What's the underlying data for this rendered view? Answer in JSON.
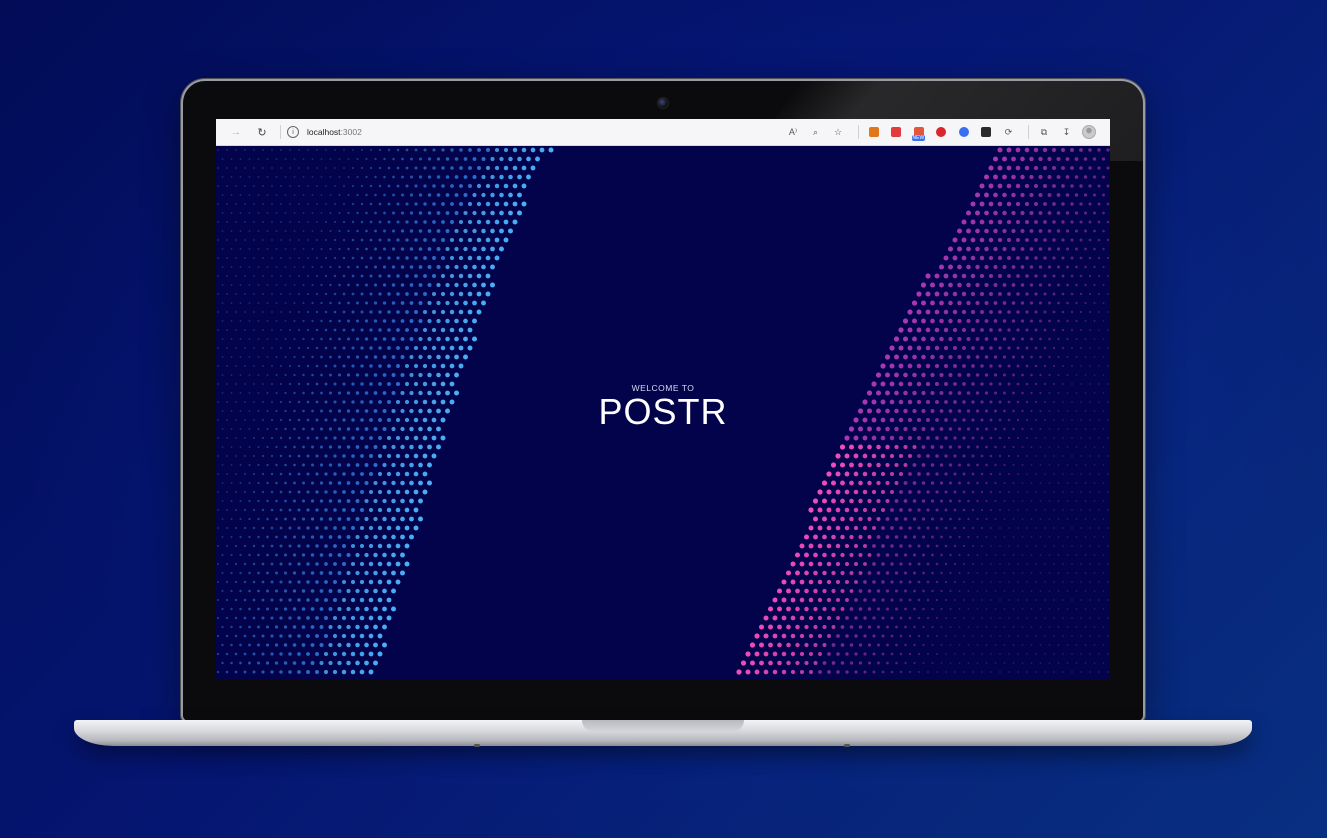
{
  "browser": {
    "url_host": "localhost",
    "url_port": ":3002",
    "extensions": [
      {
        "name": "read-aloud-icon",
        "glyph": "A⁾"
      },
      {
        "name": "zoom-icon",
        "glyph": "⌕"
      },
      {
        "name": "favorites-star-icon",
        "glyph": "☆"
      },
      {
        "name": "metamask-fox-icon",
        "color": "#e2761b"
      },
      {
        "name": "red-extension-icon",
        "color": "#e23b3b"
      },
      {
        "name": "new-extension-icon",
        "color": "#e2563b",
        "badge": "NEW"
      },
      {
        "name": "opera-red-icon",
        "color": "#d9262a"
      },
      {
        "name": "blue-globe-icon",
        "color": "#3a6ff0"
      },
      {
        "name": "dark-shield-icon",
        "color": "#2a2a2a"
      },
      {
        "name": "puzzle-extensions-icon",
        "glyph": "⚙"
      }
    ]
  },
  "hero": {
    "eyebrow": "WELCOME TO",
    "title": "POSTR"
  },
  "colors": {
    "page_background": "#02034a",
    "left_wave": "#3fa8ff",
    "right_wave": "#ff3fb0"
  }
}
